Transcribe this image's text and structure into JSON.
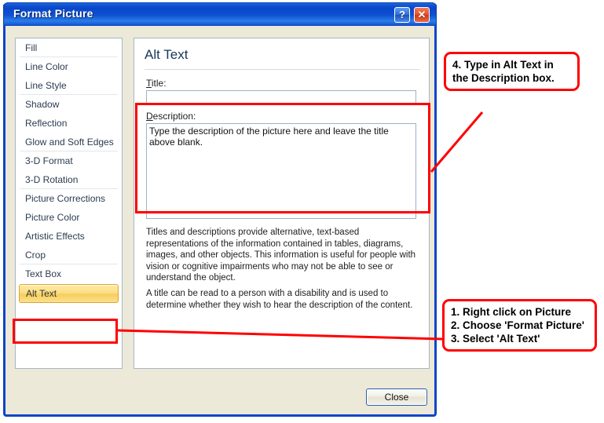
{
  "window": {
    "title": "Format Picture",
    "help_button": "?",
    "close_button_glyph": "✕",
    "help_icon_name": "help-icon",
    "close_icon_name": "close-icon",
    "titlebar_color": "#0a46c8",
    "dialog_background": "#ece9d8"
  },
  "sidebar": {
    "items": [
      {
        "label": "Fill",
        "selected": false,
        "separator_after": true
      },
      {
        "label": "Line Color",
        "selected": false,
        "separator_after": false
      },
      {
        "label": "Line Style",
        "selected": false,
        "separator_after": true
      },
      {
        "label": "Shadow",
        "selected": false,
        "separator_after": false
      },
      {
        "label": "Reflection",
        "selected": false,
        "separator_after": false
      },
      {
        "label": "Glow and Soft Edges",
        "selected": false,
        "separator_after": true
      },
      {
        "label": "3-D Format",
        "selected": false,
        "separator_after": false
      },
      {
        "label": "3-D Rotation",
        "selected": false,
        "separator_after": true
      },
      {
        "label": "Picture Corrections",
        "selected": false,
        "separator_after": false
      },
      {
        "label": "Picture Color",
        "selected": false,
        "separator_after": false
      },
      {
        "label": "Artistic Effects",
        "selected": false,
        "separator_after": false
      },
      {
        "label": "Crop",
        "selected": false,
        "separator_after": true
      },
      {
        "label": "Text Box",
        "selected": false,
        "separator_after": false
      },
      {
        "label": "Alt Text",
        "selected": true,
        "separator_after": false
      }
    ],
    "selected_highlight_color": "#f8ce5b"
  },
  "panel": {
    "heading": "Alt Text",
    "title_label": "Title:",
    "title_label_accel": "T",
    "title_value": "",
    "description_label": "Description:",
    "description_label_accel": "D",
    "description_value": "Type the description of the picture here and leave the title above blank.",
    "help_paragraph_1": "Titles and descriptions provide alternative, text-based representations of the information contained in tables, diagrams, images, and other objects. This information is useful for people with vision or cognitive impairments who may not be able to see or understand the object.",
    "help_paragraph_2": "A title can be read to a person with a disability and is used to determine whether they wish to hear the description of the content."
  },
  "footer": {
    "close_label": "Close"
  },
  "annotations": {
    "color": "#ff0000",
    "callout_top": "4. Type in Alt Text in the Description box.",
    "callout_bottom": "1. Right click on Picture\n2. Choose 'Format Picture'\n3. Select 'Alt Text'"
  }
}
